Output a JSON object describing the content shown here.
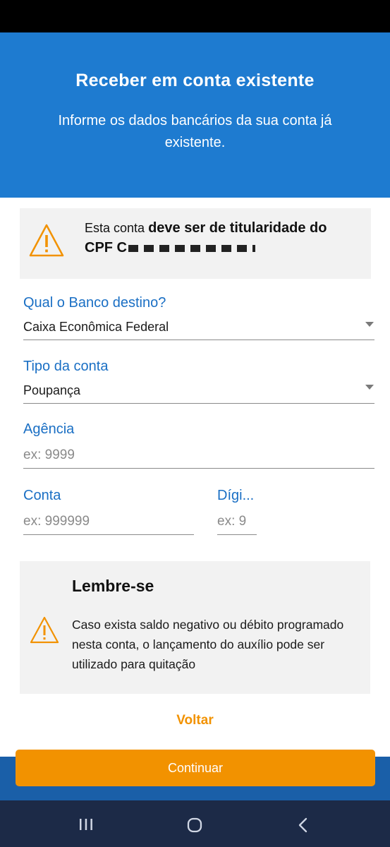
{
  "header": {
    "title": "Receber em conta existente",
    "subtitle": "Informe os dados bancários da sua conta já existente."
  },
  "warning": {
    "text_prefix": "Esta conta ",
    "text_bold": "deve ser de titularidade do",
    "cpf_label": "CPF C"
  },
  "fields": {
    "bank": {
      "label": "Qual o Banco destino?",
      "value": "Caixa Econômica Federal"
    },
    "account_type": {
      "label": "Tipo da conta",
      "value": "Poupança"
    },
    "agency": {
      "label": "Agência",
      "placeholder": "ex: 9999"
    },
    "account": {
      "label": "Conta",
      "placeholder": "ex: 999999"
    },
    "digit": {
      "label": "Dígi...",
      "placeholder": "ex: 9"
    }
  },
  "reminder": {
    "title": "Lembre-se",
    "text": "Caso exista saldo negativo ou débito programado nesta conta, o lançamento do auxílio pode ser utilizado para quitação"
  },
  "actions": {
    "back_label": "Voltar",
    "continue_label": "Continuar"
  },
  "colors": {
    "header_blue": "#1e7bd0",
    "accent_orange": "#f29200",
    "label_blue": "#1a6fc4"
  }
}
